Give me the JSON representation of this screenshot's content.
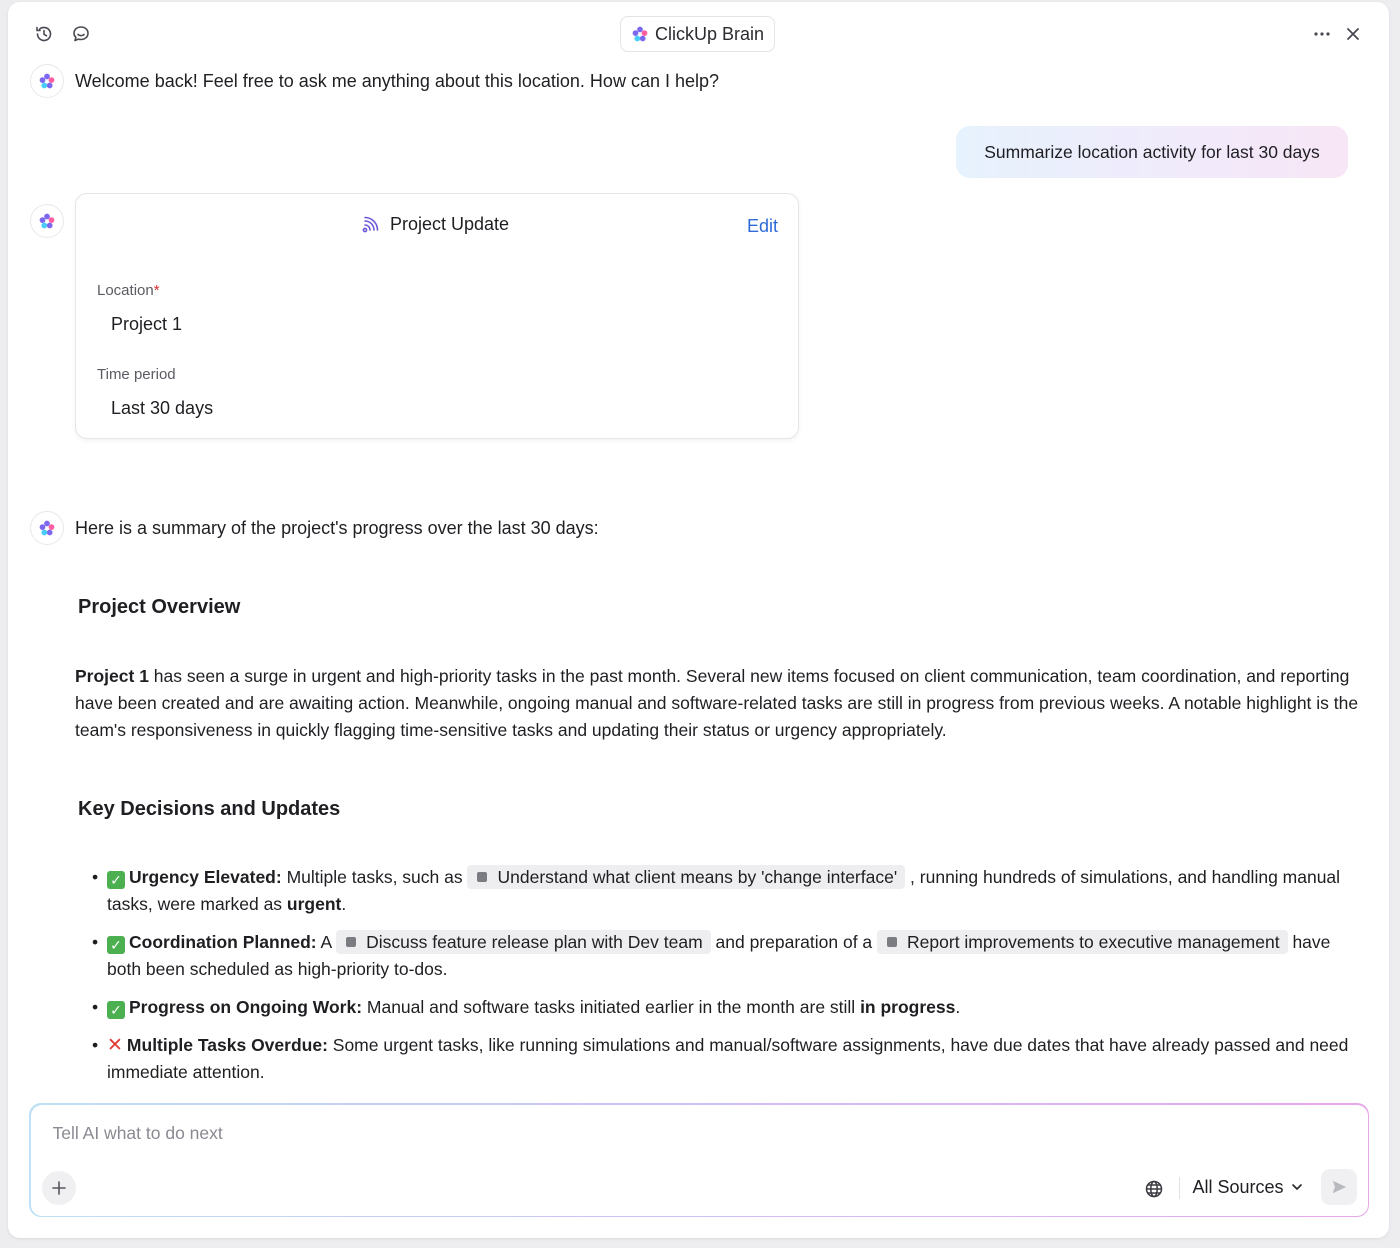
{
  "header": {
    "app_title": "ClickUp Brain",
    "icons": [
      "history-icon",
      "chat-bubble-icon",
      "more-icon",
      "close-icon"
    ]
  },
  "messages": {
    "welcome": "Welcome back! Feel free to ask me anything about this location. How can I help?",
    "user_prompt": "Summarize location activity for last 30 days",
    "summary_intro": "Here is a summary of the project's progress over the last 30 days:"
  },
  "card": {
    "title": "Project Update",
    "edit_label": "Edit",
    "location_label": "Location",
    "required_mark": "*",
    "location_value": "Project 1",
    "time_period_label": "Time period",
    "time_period_value": "Last 30 days"
  },
  "summary": {
    "overview_heading": "Project Overview",
    "overview_bold": "Project 1",
    "overview_text": " has seen a surge in urgent and high-priority tasks in the past month. Several new items focused on client communication, team coordination, and reporting have been created and are awaiting action. Meanwhile, ongoing manual and software-related tasks are still in progress from previous weeks. A notable highlight is the team's responsiveness in quickly flagging time-sensitive tasks and updating their status or urgency appropriately.",
    "decisions_heading": "Key Decisions and Updates",
    "bullet_char": "•",
    "bullets": {
      "b1": {
        "title": "Urgency Elevated:",
        "t1": " Multiple tasks, such as ",
        "chip1": "Understand what client means by 'change interface'",
        "t2": " , running hundreds of simulations, and handling manual tasks, were marked as ",
        "bold": "urgent",
        "t3": "."
      },
      "b2": {
        "title": "Coordination Planned:",
        "t1": " A ",
        "chip1": "Discuss feature release plan with Dev team",
        "t2": "  and preparation of a ",
        "chip2": "Report improvements to executive management",
        "t3": "  have both been scheduled as high-priority to-dos."
      },
      "b3": {
        "title": "Progress on Ongoing Work:",
        "t1": " Manual and software tasks initiated earlier in the month are still ",
        "bold": "in progress",
        "t2": "."
      },
      "b4": {
        "title": "Multiple Tasks Overdue:",
        "t1": " Some urgent tasks, like running simulations and manual/software assignments, have due dates that have already passed and need immediate attention."
      }
    }
  },
  "composer": {
    "placeholder": "Tell AI what to do next",
    "value": "",
    "sources_label": "All Sources"
  },
  "colors": {
    "link": "#2f6bd8",
    "check_green": "#4caf50",
    "cross_red": "#e53935",
    "required_red": "#d32f2f"
  }
}
